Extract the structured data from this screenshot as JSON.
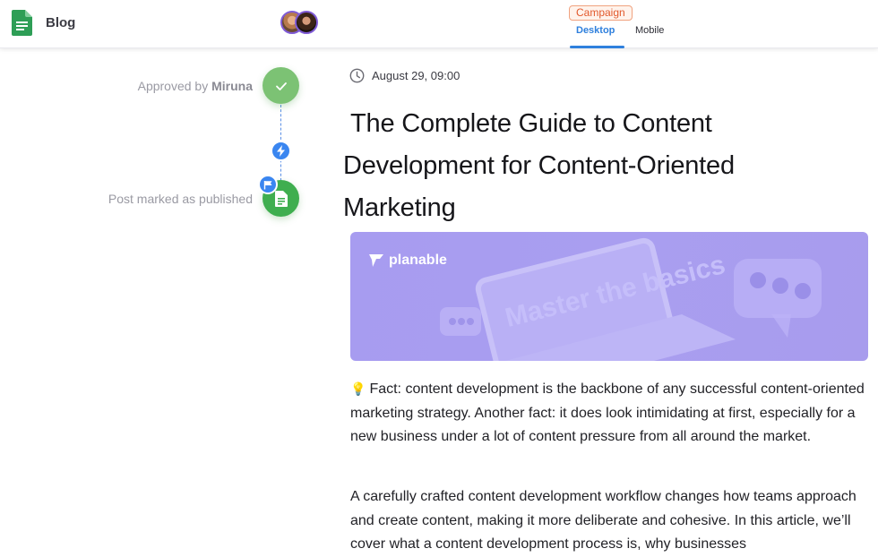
{
  "header": {
    "title": "Blog",
    "campaign_badge": "Campaign",
    "tabs": [
      {
        "label": "Desktop",
        "active": true
      },
      {
        "label": "Mobile",
        "active": false
      }
    ]
  },
  "timeline": {
    "events": [
      {
        "prefix": "Approved by ",
        "name": "Miruna",
        "icon": "check-icon"
      },
      {
        "label": "Post marked as published",
        "icon": "document-icon"
      }
    ],
    "connector_icon": "bolt-icon",
    "badge_icon": "flag-icon"
  },
  "post": {
    "date": "August 29, 09:00",
    "title_lines": [
      "The Complete Guide to Content",
      "Development for Content-Oriented",
      "Marketing"
    ],
    "hero": {
      "logo_text": "planable",
      "overlay_text": "Master the basics"
    },
    "paragraphs": [
      "Fact: content development is the backbone of any successful content-oriented marketing strategy. Another fact: it does look intimidating at first, especially for a new business under a lot of content pressure from all around the market.",
      "A carefully crafted content development workflow changes how teams approach and create content, making it more deliberate and cohesive. In this article, we’ll cover what a content development process is, why businesses"
    ]
  },
  "colors": {
    "accent": "#2f80dd",
    "success": "#5cb85c",
    "campaign": "#e2592c",
    "hero_bg": "#a99ef0"
  }
}
